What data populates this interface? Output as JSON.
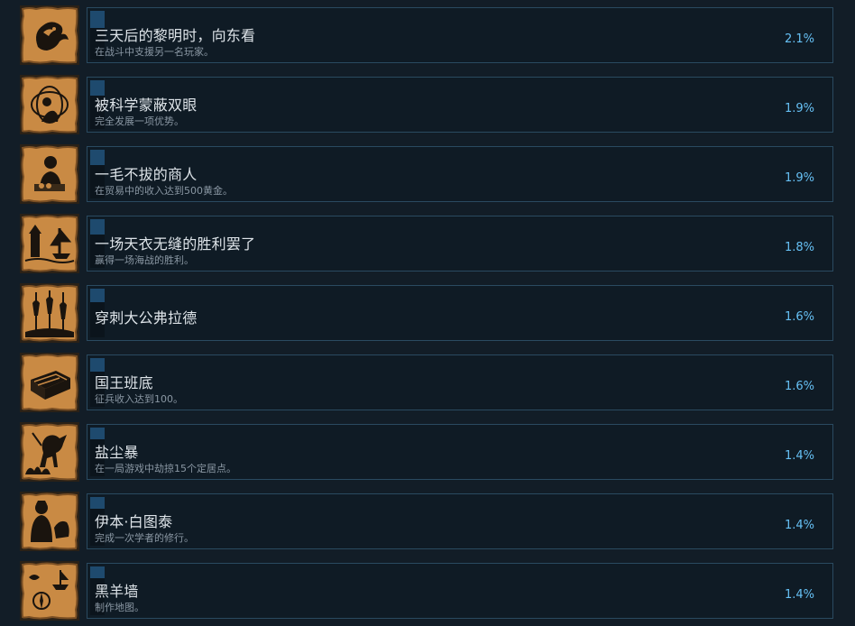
{
  "colors": {
    "background": "#121d27",
    "card_border": "#2a4a60",
    "progress_fill": "#1e4a6e",
    "title_text": "#dde3e8",
    "desc_text": "#8a97a3",
    "percent_text": "#66c0f4",
    "icon_parchment": "#c98a44"
  },
  "achievements": [
    {
      "icon": "dragon-emblem-icon",
      "title": "三天后的黎明时，向东看",
      "desc": "在战斗中支援另一名玩家。",
      "percent": "2.1%",
      "unlock_rate": 0.021
    },
    {
      "icon": "astronomer-scholar-icon",
      "title": "被科学蒙蔽双眼",
      "desc": "完全发展一项优势。",
      "percent": "1.9%",
      "unlock_rate": 0.019
    },
    {
      "icon": "merchant-counting-coins-icon",
      "title": "一毛不拔的商人",
      "desc": "在贸易中的收入达到500黄金。",
      "percent": "1.9%",
      "unlock_rate": 0.019
    },
    {
      "icon": "sailing-ship-harbor-icon",
      "title": "一场天衣无缝的胜利罢了",
      "desc": "赢得一场海战的胜利。",
      "percent": "1.8%",
      "unlock_rate": 0.018
    },
    {
      "icon": "impaled-figures-icon",
      "title": "穿刺大公弗拉德",
      "desc": "",
      "percent": "1.6%",
      "unlock_rate": 0.016
    },
    {
      "icon": "treasure-chest-gold-icon",
      "title": "国王班底",
      "desc": "征兵收入达到100。",
      "percent": "1.6%",
      "unlock_rate": 0.016
    },
    {
      "icon": "rearing-horse-fire-icon",
      "title": "盐尘暴",
      "desc": "在一局游戏中劫掠15个定居点。",
      "percent": "1.4%",
      "unlock_rate": 0.014
    },
    {
      "icon": "scholar-traveler-icon",
      "title": "伊本·白图泰",
      "desc": "完成一次学者的修行。",
      "percent": "1.4%",
      "unlock_rate": 0.014
    },
    {
      "icon": "map-compass-ship-icon",
      "title": "黑羊墙",
      "desc": "制作地图。",
      "percent": "1.4%",
      "unlock_rate": 0.014
    }
  ]
}
